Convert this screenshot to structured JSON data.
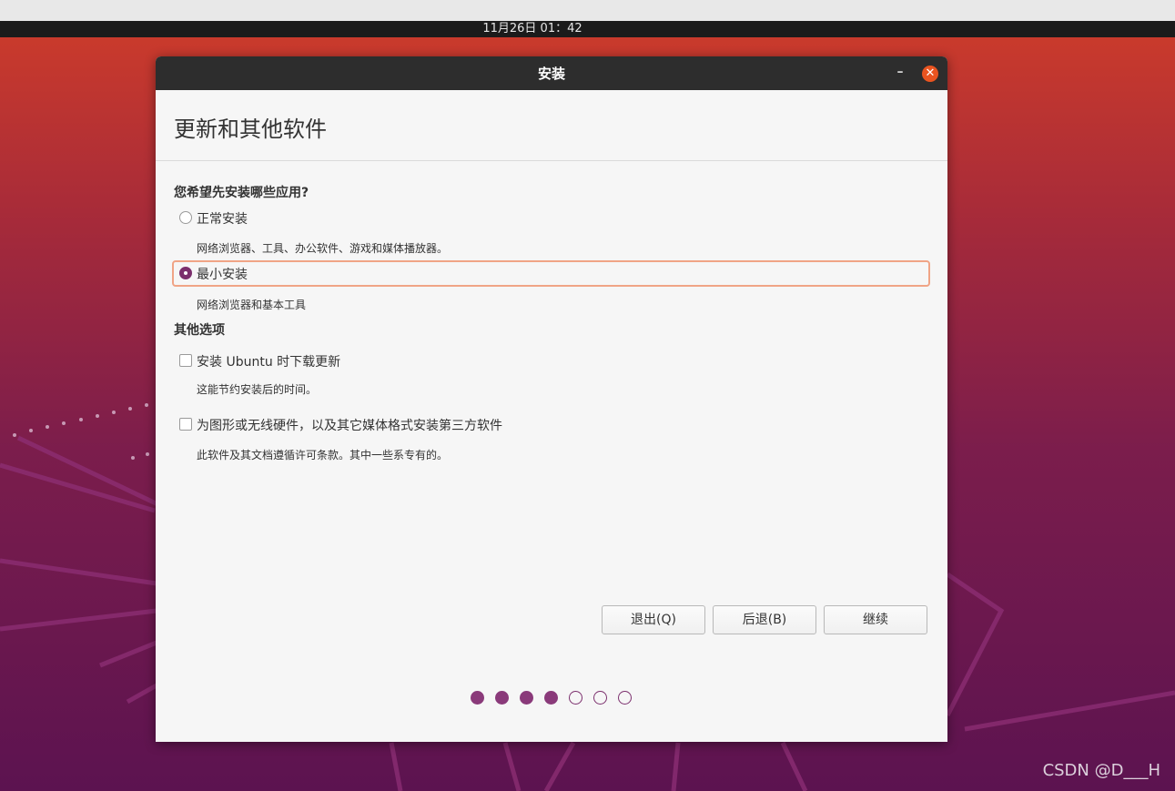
{
  "topbar": {
    "clock": "11月26日  01：42"
  },
  "window": {
    "title": "安装",
    "minimize_label": "–",
    "close_label": "✕",
    "page_title": "更新和其他软件",
    "question": "您希望先安装哪些应用?",
    "install_options": [
      {
        "label": "正常安装",
        "description": "网络浏览器、工具、办公软件、游戏和媒体播放器。",
        "selected": false
      },
      {
        "label": "最小安装",
        "description": "网络浏览器和基本工具",
        "selected": true
      }
    ],
    "other_heading": "其他选项",
    "other_options": [
      {
        "label": "安装 Ubuntu 时下载更新",
        "description": "这能节约安装后的时间。",
        "checked": false
      },
      {
        "label": "为图形或无线硬件，以及其它媒体格式安装第三方软件",
        "description": "此软件及其文档遵循许可条款。其中一些系专有的。",
        "checked": false
      }
    ],
    "buttons": {
      "quit": "退出(Q)",
      "back": "后退(B)",
      "continue": "继续"
    },
    "progress": {
      "total_steps": 7,
      "completed_steps": 4
    }
  },
  "colors": {
    "accent": "#7b2f6d",
    "close": "#e95420",
    "focus": "#f0a486"
  },
  "watermark": "CSDN @D___H"
}
